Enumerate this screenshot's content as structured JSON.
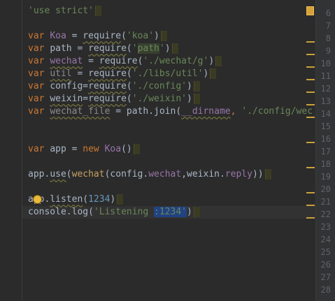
{
  "editor": {
    "line_numbers": [
      "6",
      "7",
      "8",
      "9",
      "10",
      "11",
      "12",
      "13",
      "14",
      "15",
      "16",
      "17",
      "18",
      "19",
      "20",
      "21",
      "22",
      "23",
      "24",
      "25",
      "26",
      "27",
      "28"
    ],
    "code": {
      "use_strict": "'use strict'",
      "l3": {
        "kw": "var",
        "name": "Koa",
        "eq": " = ",
        "fn": "require",
        "open": "(",
        "arg": "'koa'",
        "close": ")"
      },
      "l4": {
        "kw": "var",
        "name": "path",
        "eq": " = ",
        "fn": "require",
        "open": "(",
        "q1": "'",
        "arg": "path",
        "q2": "'",
        "close": ")"
      },
      "l5": {
        "kw": "var",
        "name": "wechat",
        "eq": " = ",
        "fn": "require",
        "open": "(",
        "arg": "'./wechat/g'",
        "close": ")"
      },
      "l6": {
        "kw": "var",
        "name": "util",
        "eq": " = ",
        "fn": "require",
        "open": "(",
        "arg": "'./libs/util'",
        "close": ")"
      },
      "l7": {
        "kw": "var",
        "name": "config",
        "eq": "=",
        "fn": "require",
        "open": "(",
        "arg": "'./config'",
        "close": ")"
      },
      "l8": {
        "kw": "var",
        "name": "weixin",
        "eq": "=",
        "fn": "require",
        "open": "(",
        "arg": "'./weixin'",
        "close": ")"
      },
      "l9": {
        "kw": "var",
        "name": "wechat_file",
        "eq": " = ",
        "obj": "path",
        "dot": ".",
        "fn": "join",
        "open": "(",
        "arg1": "__dirname",
        "comma": ", ",
        "arg2": "'./config/wec"
      },
      "l12": {
        "kw": "var",
        "name": "app",
        "eq": " = ",
        "newkw": "new",
        "cls": "Koa",
        "parens": "()"
      },
      "l14": {
        "obj": "app",
        "dot": ".",
        "fn": "use",
        "open": "(",
        "call": "wechat",
        "open2": "(",
        "a1": "config",
        "dot2": ".",
        "a1p": "wechat",
        "comma": ",",
        "a2": "weixin",
        "dot3": ".",
        "a2p": "reply",
        "close": "))"
      },
      "l16": {
        "obj": "app",
        "dot": ".",
        "fn": "listen",
        "open": "(",
        "arg": "1234",
        "close": ")"
      },
      "l17": {
        "obj": "console",
        "dot": ".",
        "fn": "log",
        "open": "(",
        "str1": "'Listening ",
        "str2": ":1234'",
        "close": ")"
      }
    }
  }
}
